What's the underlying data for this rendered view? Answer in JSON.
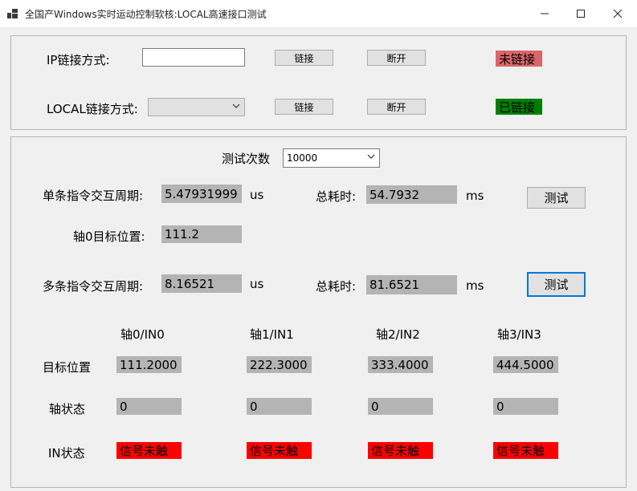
{
  "window": {
    "title": "全国产Windows实时运动控制软核:LOCAL高速接口测试"
  },
  "connection": {
    "ip_label": "IP链接方式:",
    "ip_value": "",
    "ip_connect": "链接",
    "ip_disconnect": "断开",
    "ip_status": "未链接",
    "ip_status_color": "#d9666a",
    "local_label": "LOCAL链接方式:",
    "local_value": "",
    "local_connect": "链接",
    "local_disconnect": "断开",
    "local_status": "已链接",
    "local_status_color": "#008000"
  },
  "test": {
    "count_label": "测试次数",
    "count_value": "10000",
    "single_period_label": "单条指令交互周期:",
    "single_period_value": "5.47931999",
    "single_unit": "us",
    "single_total_label": "总耗时:",
    "single_total_value": "54.7932",
    "single_total_unit": "ms",
    "single_test_button": "测试",
    "axis0_target_label": "轴0目标位置:",
    "axis0_target_value": "111.2",
    "multi_period_label": "多条指令交互周期:",
    "multi_period_value": "8.16521",
    "multi_unit": "us",
    "multi_total_label": "总耗时:",
    "multi_total_value": "81.6521",
    "multi_total_unit": "ms",
    "multi_test_button": "测试"
  },
  "axes": {
    "row_labels": {
      "target": "目标位置",
      "state": "轴状态",
      "in": "IN状态"
    },
    "columns": [
      {
        "header": "轴0/IN0",
        "target": "111.2000",
        "state": "0",
        "in": "信号未触"
      },
      {
        "header": "轴1/IN1",
        "target": "222.3000",
        "state": "0",
        "in": "信号未触"
      },
      {
        "header": "轴2/IN2",
        "target": "333.4000",
        "state": "0",
        "in": "信号未触"
      },
      {
        "header": "轴3/IN3",
        "target": "444.5000",
        "state": "0",
        "in": "信号未触"
      }
    ]
  },
  "icons": {
    "app": "app-icon",
    "minimize": "minimize-icon",
    "maximize": "maximize-icon",
    "close": "close-icon",
    "dropdown": "chevron-down-icon"
  }
}
